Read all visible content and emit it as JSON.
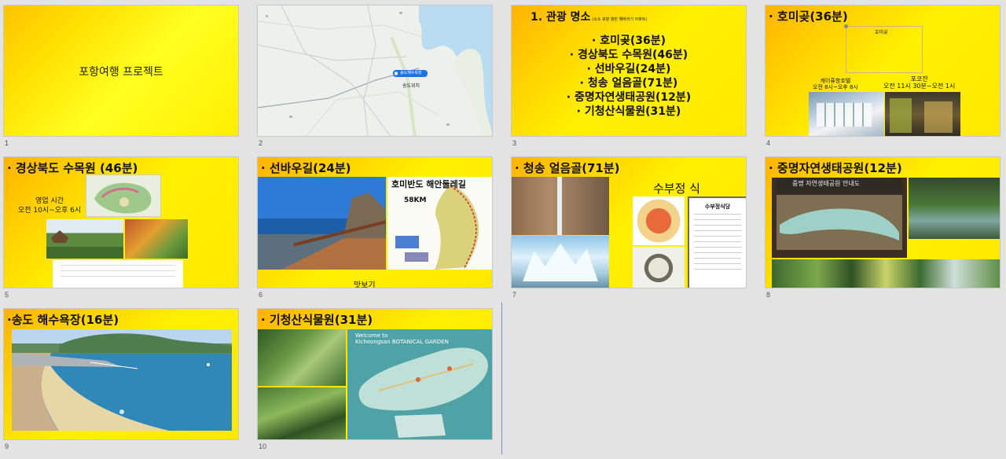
{
  "slides": [
    {
      "num": "1",
      "title": "포항여행 프로젝트"
    },
    {
      "num": "2"
    },
    {
      "num": "3",
      "heading": "1. 관광 명소",
      "heading_note": "(소소 포항 항만 해바라기 아파트)",
      "items": [
        "· 호미곶(36분)",
        "· 경상북도 수목원(46분)",
        "· 선바우길(24분)",
        "· 청송 얼음골(71분)",
        "· 중명자연생태공원(12분)",
        "· 기청산식물원(31분)"
      ]
    },
    {
      "num": "4",
      "title": "· 호미곶(36분)",
      "box_label": "호미곶",
      "left_label_1": "캐이퓨항호텔",
      "left_label_2": "오전 8시~오후 8시",
      "right_label_1": "포코잔",
      "right_label_2": "오전 11시 30분~오전 1시"
    },
    {
      "num": "5",
      "title": "· 경상북도 수목원 (46분)",
      "hours_label": "영업 시간",
      "hours_value": "오전 10시~오후 6시"
    },
    {
      "num": "6",
      "title": "· 선바우길(24분)",
      "map_title": "호미반도 해안둘레길",
      "distance": "58KM",
      "caption": "맛보기"
    },
    {
      "num": "7",
      "title": "· 청송 얼음골(71분)",
      "caption": "수부정 식",
      "menu_title": "수부정식당"
    },
    {
      "num": "8",
      "title": "· 중명자연생태공원(12분)",
      "sign_text": "중명 자연생태공원 안내도"
    },
    {
      "num": "9",
      "title": "·송도 해수욕장(16분)"
    },
    {
      "num": "10",
      "title": "· 기청산식물원(31분)",
      "sign_welcome": "Welcome to",
      "sign_name": "Kicheongsan BOTANICAL GARDEN"
    }
  ],
  "map": {
    "marker_label": "송도해수욕장",
    "place_label": "송도위치"
  }
}
